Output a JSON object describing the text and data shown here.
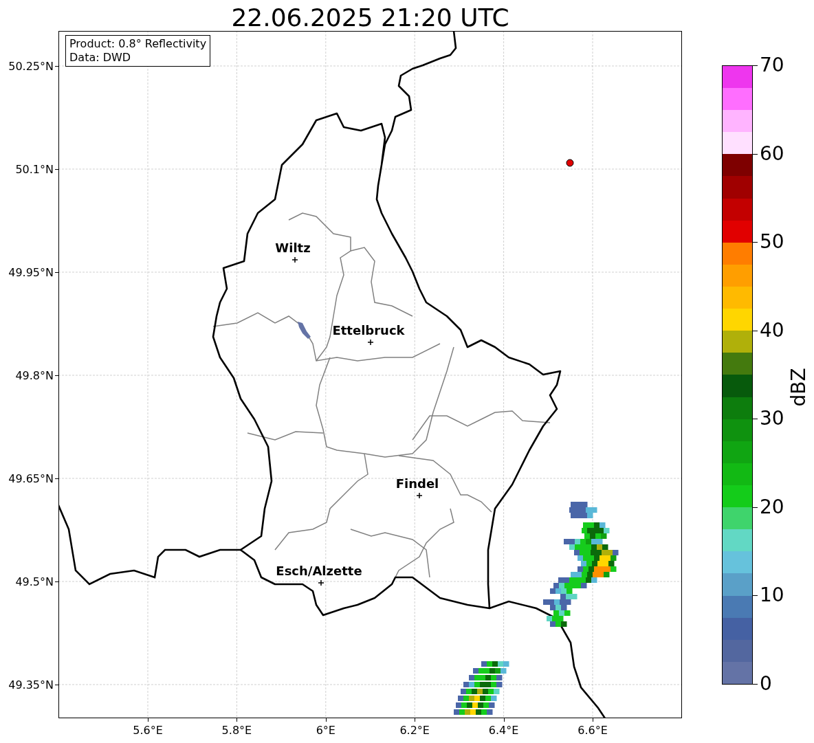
{
  "title": "22.06.2025 21:20 UTC",
  "info_box": {
    "lines": [
      "Product: 0.8° Reflectivity",
      "Data: DWD"
    ]
  },
  "map": {
    "cities": [
      {
        "name": "Wiltz"
      },
      {
        "name": "Ettelbruck"
      },
      {
        "name": "Findel"
      },
      {
        "name": "Esch/Alzette"
      }
    ],
    "x_ticks": [
      "5.6°E",
      "5.8°E",
      "6°E",
      "6.2°E",
      "6.4°E",
      "6.6°E"
    ],
    "y_ticks": [
      "50.25°N",
      "50.1°N",
      "49.95°N",
      "49.8°N",
      "49.65°N",
      "49.5°N",
      "49.35°N"
    ]
  },
  "colorbar": {
    "label": "dBZ",
    "ticks": [
      "70",
      "60",
      "50",
      "40",
      "30",
      "20",
      "10",
      "0"
    ],
    "bins": [
      {
        "color": "#6473a6"
      },
      {
        "color": "#53679f"
      },
      {
        "color": "#4561a3"
      },
      {
        "color": "#4a7ab3"
      },
      {
        "color": "#5aa0c8"
      },
      {
        "color": "#66c2dc"
      },
      {
        "color": "#62d8c4"
      },
      {
        "color": "#3fd46c"
      },
      {
        "color": "#14cc1a"
      },
      {
        "color": "#12b914"
      },
      {
        "color": "#10a512"
      },
      {
        "color": "#0f920f"
      },
      {
        "color": "#0d7d0d"
      },
      {
        "color": "#075a0c"
      },
      {
        "color": "#447a0e"
      },
      {
        "color": "#b0b00a"
      },
      {
        "color": "#ffd600"
      },
      {
        "color": "#ffba00"
      },
      {
        "color": "#ff9e00"
      },
      {
        "color": "#ff7d00"
      },
      {
        "color": "#e10000"
      },
      {
        "color": "#c30000"
      },
      {
        "color": "#a00000"
      },
      {
        "color": "#7e0000"
      },
      {
        "color": "#ffe0ff"
      },
      {
        "color": "#ffb4ff"
      },
      {
        "color": "#ff6eff"
      },
      {
        "color": "#ee36ee"
      }
    ]
  }
}
